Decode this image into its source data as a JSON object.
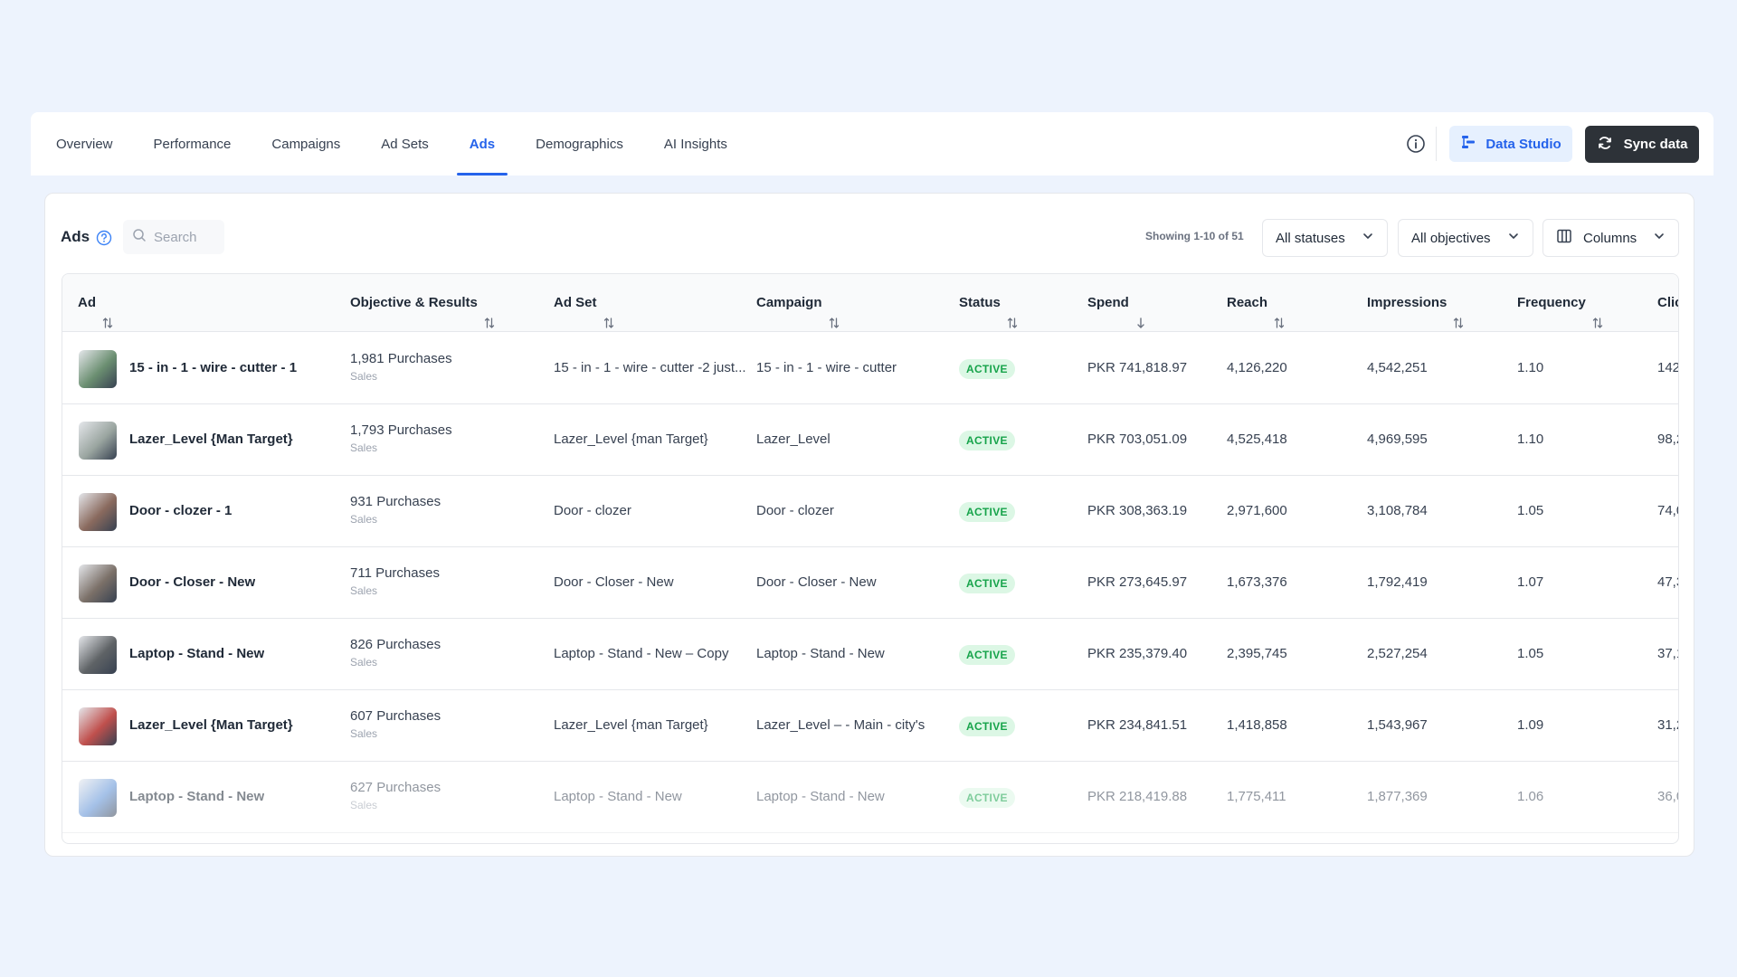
{
  "nav": {
    "tabs": [
      {
        "label": "Overview"
      },
      {
        "label": "Performance"
      },
      {
        "label": "Campaigns"
      },
      {
        "label": "Ad Sets"
      },
      {
        "label": "Ads",
        "active": true
      },
      {
        "label": "Demographics"
      },
      {
        "label": "AI Insights"
      }
    ],
    "data_studio_label": "Data Studio",
    "sync_label": "Sync data"
  },
  "ads_panel": {
    "title": "Ads",
    "search_placeholder": "Search",
    "showing_text": "Showing 1-10 of 51",
    "status_filter": "All statuses",
    "objective_filter": "All objectives",
    "columns_label": "Columns"
  },
  "table": {
    "headers": {
      "ad": "Ad",
      "objective": "Objective & Results",
      "adset": "Ad Set",
      "campaign": "Campaign",
      "status": "Status",
      "spend": "Spend",
      "reach": "Reach",
      "impressions": "Impressions",
      "frequency": "Frequency",
      "clicks": "Clic"
    },
    "rows": [
      {
        "ad": "15 - in - 1 - wire - cutter - 1",
        "result": "1,981 Purchases",
        "objective": "Sales",
        "adset": "15 - in - 1 - wire - cutter -2 just...",
        "campaign": "15 - in - 1 - wire - cutter",
        "status": "ACTIVE",
        "spend": "PKR 741,818.97",
        "reach": "4,126,220",
        "impressions": "4,542,251",
        "frequency": "1.10",
        "clicks": "142",
        "thumb_color": "#6b8f71"
      },
      {
        "ad": "Lazer_Level {Man Target}",
        "result": "1,793 Purchases",
        "objective": "Sales",
        "adset": "Lazer_Level {man Target}",
        "campaign": "Lazer_Level",
        "status": "ACTIVE",
        "spend": "PKR 703,051.09",
        "reach": "4,525,418",
        "impressions": "4,969,595",
        "frequency": "1.10",
        "clicks": "98,2",
        "thumb_color": "#9aa5a0"
      },
      {
        "ad": "Door - clozer - 1",
        "result": "931 Purchases",
        "objective": "Sales",
        "adset": "Door - clozer",
        "campaign": "Door - clozer",
        "status": "ACTIVE",
        "spend": "PKR 308,363.19",
        "reach": "2,971,600",
        "impressions": "3,108,784",
        "frequency": "1.05",
        "clicks": "74,0",
        "thumb_color": "#8a6a5e"
      },
      {
        "ad": "Door - Closer - New",
        "result": "711 Purchases",
        "objective": "Sales",
        "adset": "Door - Closer - New",
        "campaign": "Door - Closer - New",
        "status": "ACTIVE",
        "spend": "PKR 273,645.97",
        "reach": "1,673,376",
        "impressions": "1,792,419",
        "frequency": "1.07",
        "clicks": "47,3",
        "thumb_color": "#7b7068"
      },
      {
        "ad": "Laptop - Stand - New",
        "result": "826 Purchases",
        "objective": "Sales",
        "adset": "Laptop - Stand - New – Copy",
        "campaign": "Laptop - Stand - New",
        "status": "ACTIVE",
        "spend": "PKR 235,379.40",
        "reach": "2,395,745",
        "impressions": "2,527,254",
        "frequency": "1.05",
        "clicks": "37,1",
        "thumb_color": "#5f6366"
      },
      {
        "ad": "Lazer_Level {Man Target}",
        "result": "607 Purchases",
        "objective": "Sales",
        "adset": "Lazer_Level {man Target}",
        "campaign": "Lazer_Level – - Main - city's",
        "status": "ACTIVE",
        "spend": "PKR 234,841.51",
        "reach": "1,418,858",
        "impressions": "1,543,967",
        "frequency": "1.09",
        "clicks": "31,2",
        "thumb_color": "#c0504d"
      },
      {
        "ad": "Laptop - Stand - New",
        "result": "627 Purchases",
        "objective": "Sales",
        "adset": "Laptop - Stand - New",
        "campaign": "Laptop - Stand - New",
        "status": "ACTIVE",
        "spend": "PKR 218,419.88",
        "reach": "1,775,411",
        "impressions": "1,877,369",
        "frequency": "1.06",
        "clicks": "36,0",
        "thumb_color": "#5b8fd6",
        "faded": true
      }
    ]
  },
  "colors": {
    "accent": "#2563eb",
    "active_badge_bg": "#dcf7e5",
    "active_badge_text": "#16a34a",
    "page_bg": "#edf3fd",
    "sync_button_bg": "#2d3238"
  }
}
